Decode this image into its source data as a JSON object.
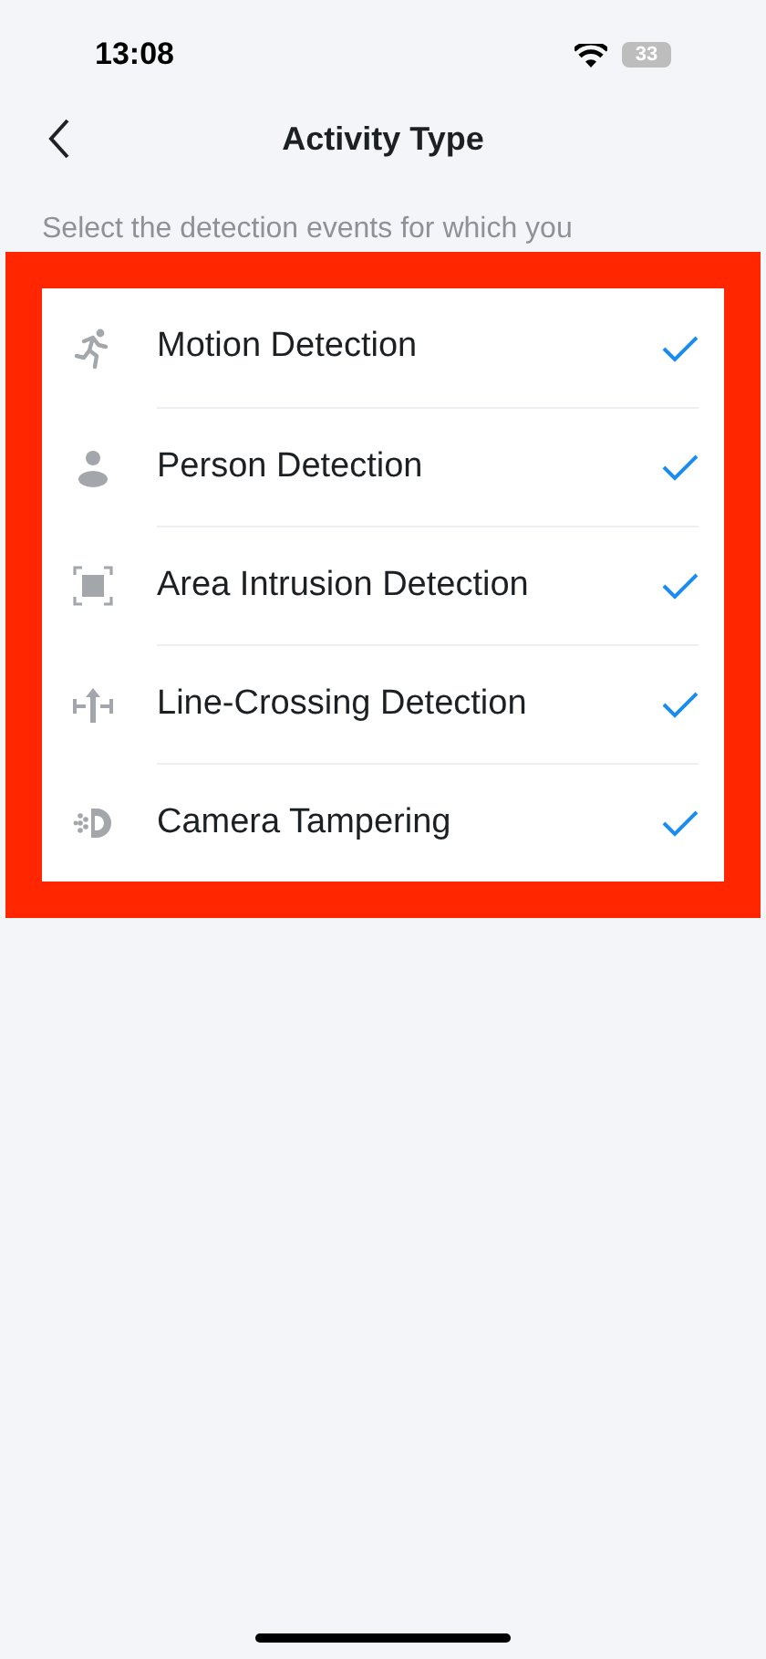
{
  "status_bar": {
    "time": "13:08",
    "battery": "33"
  },
  "header": {
    "title": "Activity Type"
  },
  "description": "Select the detection events for which you",
  "items": [
    {
      "kind": "motion",
      "label": "Motion Detection",
      "checked": true
    },
    {
      "kind": "person",
      "label": "Person Detection",
      "checked": true
    },
    {
      "kind": "area",
      "label": "Area Intrusion Detection",
      "checked": true
    },
    {
      "kind": "line",
      "label": "Line-Crossing Detection",
      "checked": true
    },
    {
      "kind": "tamper",
      "label": "Camera Tampering",
      "checked": true
    }
  ]
}
